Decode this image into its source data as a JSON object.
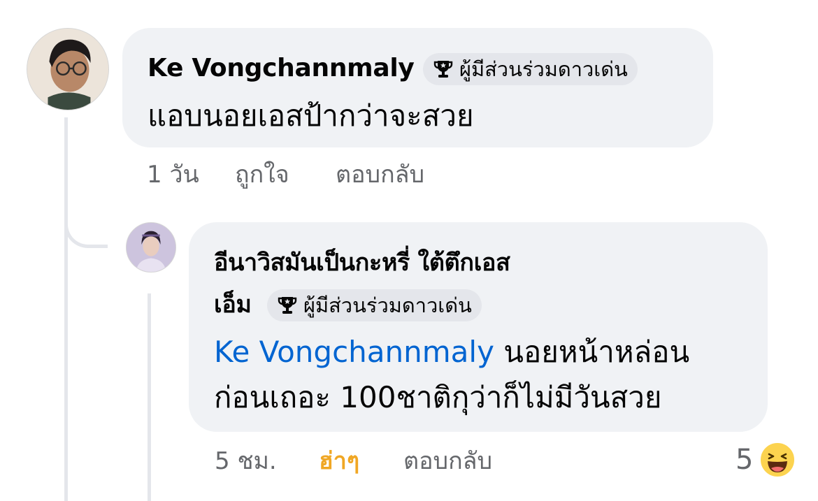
{
  "comment": {
    "author": "Ke Vongchannmaly",
    "badge": "ผู้มีส่วนร่วมดาวเด่น",
    "text": "แอบนอยเอสป้ากว่าจะสวย",
    "timestamp": "1 วัน",
    "like_label": "ถูกใจ",
    "reply_label": "ตอบกลับ"
  },
  "reply": {
    "author_line1": "อีนาวิสมันเป็นกะหรี่ ใต้ตึกเอส",
    "author_line2": "เอ็ม",
    "badge": "ผู้มีส่วนร่วมดาวเด่น",
    "mention": "Ke Vongchannmaly",
    "text_line1": " นอยหน้าหล่อน",
    "text_line2": "ก่อนเถอะ 100ชาติกุว่าก็ไม่มีวันสวย",
    "timestamp": "5 ชม.",
    "reaction_label": "ฮ่าๆ",
    "reply_label": "ตอบกลับ",
    "reaction_count": "5",
    "reaction_icon": "haha-emoji-icon"
  },
  "colors": {
    "bubble": "#f0f2f5",
    "badge": "#e4e6eb",
    "mention": "#0064d1",
    "haha": "#f0a724",
    "secondary_text": "#65676b"
  }
}
